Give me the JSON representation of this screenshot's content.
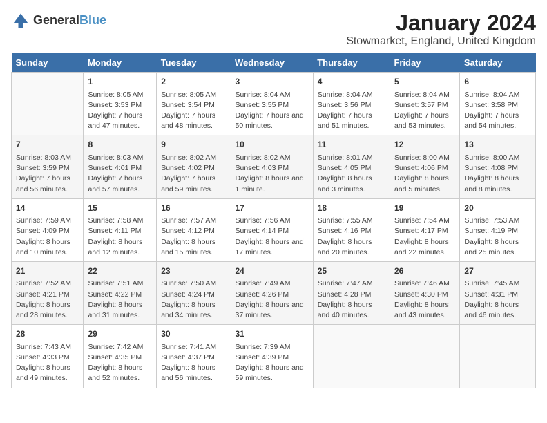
{
  "logo": {
    "text_general": "General",
    "text_blue": "Blue"
  },
  "title": "January 2024",
  "location": "Stowmarket, England, United Kingdom",
  "days_of_week": [
    "Sunday",
    "Monday",
    "Tuesday",
    "Wednesday",
    "Thursday",
    "Friday",
    "Saturday"
  ],
  "weeks": [
    [
      {
        "day": "",
        "sunrise": "",
        "sunset": "",
        "daylight": ""
      },
      {
        "day": "1",
        "sunrise": "Sunrise: 8:05 AM",
        "sunset": "Sunset: 3:53 PM",
        "daylight": "Daylight: 7 hours and 47 minutes."
      },
      {
        "day": "2",
        "sunrise": "Sunrise: 8:05 AM",
        "sunset": "Sunset: 3:54 PM",
        "daylight": "Daylight: 7 hours and 48 minutes."
      },
      {
        "day": "3",
        "sunrise": "Sunrise: 8:04 AM",
        "sunset": "Sunset: 3:55 PM",
        "daylight": "Daylight: 7 hours and 50 minutes."
      },
      {
        "day": "4",
        "sunrise": "Sunrise: 8:04 AM",
        "sunset": "Sunset: 3:56 PM",
        "daylight": "Daylight: 7 hours and 51 minutes."
      },
      {
        "day": "5",
        "sunrise": "Sunrise: 8:04 AM",
        "sunset": "Sunset: 3:57 PM",
        "daylight": "Daylight: 7 hours and 53 minutes."
      },
      {
        "day": "6",
        "sunrise": "Sunrise: 8:04 AM",
        "sunset": "Sunset: 3:58 PM",
        "daylight": "Daylight: 7 hours and 54 minutes."
      }
    ],
    [
      {
        "day": "7",
        "sunrise": "Sunrise: 8:03 AM",
        "sunset": "Sunset: 3:59 PM",
        "daylight": "Daylight: 7 hours and 56 minutes."
      },
      {
        "day": "8",
        "sunrise": "Sunrise: 8:03 AM",
        "sunset": "Sunset: 4:01 PM",
        "daylight": "Daylight: 7 hours and 57 minutes."
      },
      {
        "day": "9",
        "sunrise": "Sunrise: 8:02 AM",
        "sunset": "Sunset: 4:02 PM",
        "daylight": "Daylight: 7 hours and 59 minutes."
      },
      {
        "day": "10",
        "sunrise": "Sunrise: 8:02 AM",
        "sunset": "Sunset: 4:03 PM",
        "daylight": "Daylight: 8 hours and 1 minute."
      },
      {
        "day": "11",
        "sunrise": "Sunrise: 8:01 AM",
        "sunset": "Sunset: 4:05 PM",
        "daylight": "Daylight: 8 hours and 3 minutes."
      },
      {
        "day": "12",
        "sunrise": "Sunrise: 8:00 AM",
        "sunset": "Sunset: 4:06 PM",
        "daylight": "Daylight: 8 hours and 5 minutes."
      },
      {
        "day": "13",
        "sunrise": "Sunrise: 8:00 AM",
        "sunset": "Sunset: 4:08 PM",
        "daylight": "Daylight: 8 hours and 8 minutes."
      }
    ],
    [
      {
        "day": "14",
        "sunrise": "Sunrise: 7:59 AM",
        "sunset": "Sunset: 4:09 PM",
        "daylight": "Daylight: 8 hours and 10 minutes."
      },
      {
        "day": "15",
        "sunrise": "Sunrise: 7:58 AM",
        "sunset": "Sunset: 4:11 PM",
        "daylight": "Daylight: 8 hours and 12 minutes."
      },
      {
        "day": "16",
        "sunrise": "Sunrise: 7:57 AM",
        "sunset": "Sunset: 4:12 PM",
        "daylight": "Daylight: 8 hours and 15 minutes."
      },
      {
        "day": "17",
        "sunrise": "Sunrise: 7:56 AM",
        "sunset": "Sunset: 4:14 PM",
        "daylight": "Daylight: 8 hours and 17 minutes."
      },
      {
        "day": "18",
        "sunrise": "Sunrise: 7:55 AM",
        "sunset": "Sunset: 4:16 PM",
        "daylight": "Daylight: 8 hours and 20 minutes."
      },
      {
        "day": "19",
        "sunrise": "Sunrise: 7:54 AM",
        "sunset": "Sunset: 4:17 PM",
        "daylight": "Daylight: 8 hours and 22 minutes."
      },
      {
        "day": "20",
        "sunrise": "Sunrise: 7:53 AM",
        "sunset": "Sunset: 4:19 PM",
        "daylight": "Daylight: 8 hours and 25 minutes."
      }
    ],
    [
      {
        "day": "21",
        "sunrise": "Sunrise: 7:52 AM",
        "sunset": "Sunset: 4:21 PM",
        "daylight": "Daylight: 8 hours and 28 minutes."
      },
      {
        "day": "22",
        "sunrise": "Sunrise: 7:51 AM",
        "sunset": "Sunset: 4:22 PM",
        "daylight": "Daylight: 8 hours and 31 minutes."
      },
      {
        "day": "23",
        "sunrise": "Sunrise: 7:50 AM",
        "sunset": "Sunset: 4:24 PM",
        "daylight": "Daylight: 8 hours and 34 minutes."
      },
      {
        "day": "24",
        "sunrise": "Sunrise: 7:49 AM",
        "sunset": "Sunset: 4:26 PM",
        "daylight": "Daylight: 8 hours and 37 minutes."
      },
      {
        "day": "25",
        "sunrise": "Sunrise: 7:47 AM",
        "sunset": "Sunset: 4:28 PM",
        "daylight": "Daylight: 8 hours and 40 minutes."
      },
      {
        "day": "26",
        "sunrise": "Sunrise: 7:46 AM",
        "sunset": "Sunset: 4:30 PM",
        "daylight": "Daylight: 8 hours and 43 minutes."
      },
      {
        "day": "27",
        "sunrise": "Sunrise: 7:45 AM",
        "sunset": "Sunset: 4:31 PM",
        "daylight": "Daylight: 8 hours and 46 minutes."
      }
    ],
    [
      {
        "day": "28",
        "sunrise": "Sunrise: 7:43 AM",
        "sunset": "Sunset: 4:33 PM",
        "daylight": "Daylight: 8 hours and 49 minutes."
      },
      {
        "day": "29",
        "sunrise": "Sunrise: 7:42 AM",
        "sunset": "Sunset: 4:35 PM",
        "daylight": "Daylight: 8 hours and 52 minutes."
      },
      {
        "day": "30",
        "sunrise": "Sunrise: 7:41 AM",
        "sunset": "Sunset: 4:37 PM",
        "daylight": "Daylight: 8 hours and 56 minutes."
      },
      {
        "day": "31",
        "sunrise": "Sunrise: 7:39 AM",
        "sunset": "Sunset: 4:39 PM",
        "daylight": "Daylight: 8 hours and 59 minutes."
      },
      {
        "day": "",
        "sunrise": "",
        "sunset": "",
        "daylight": ""
      },
      {
        "day": "",
        "sunrise": "",
        "sunset": "",
        "daylight": ""
      },
      {
        "day": "",
        "sunrise": "",
        "sunset": "",
        "daylight": ""
      }
    ]
  ]
}
